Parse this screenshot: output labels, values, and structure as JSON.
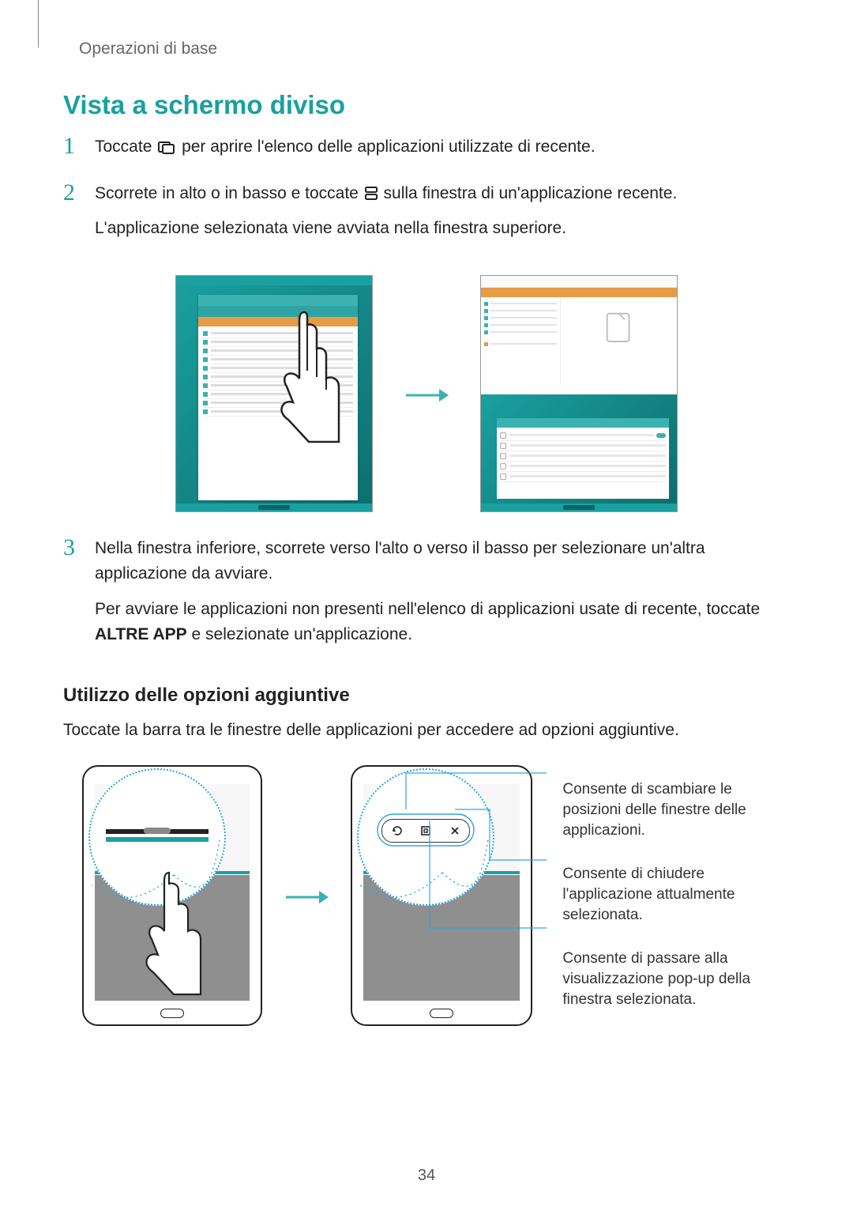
{
  "breadcrumb": "Operazioni di base",
  "section_title": "Vista a schermo diviso",
  "steps": {
    "s1": {
      "num": "1",
      "pre": "Toccate ",
      "post": " per aprire l'elenco delle applicazioni utilizzate di recente."
    },
    "s2": {
      "num": "2",
      "pre": "Scorrete in alto o in basso e toccate ",
      "post": " sulla finestra di un'applicazione recente.",
      "para2": "L'applicazione selezionata viene avviata nella finestra superiore."
    },
    "s3": {
      "num": "3",
      "para1": "Nella finestra inferiore, scorrete verso l'alto o verso il basso per selezionare un'altra applicazione da avviare.",
      "para2_pre": "Per avviare le applicazioni non presenti nell'elenco di applicazioni usate di recente, toccate ",
      "para2_bold": "ALTRE APP",
      "para2_post": " e selezionate un'applicazione."
    }
  },
  "subsection_title": "Utilizzo delle opzioni aggiuntive",
  "subsection_para": "Toccate la barra tra le finestre delle applicazioni per accedere ad opzioni aggiuntive.",
  "callouts": {
    "swap": "Consente di scambiare le posizioni delle finestre delle applicazioni.",
    "close": "Consente di chiudere l'applicazione attualmente selezionata.",
    "popup": "Consente di passare alla visualizzazione pop-up della finestra selezionata."
  },
  "page_number": "34"
}
